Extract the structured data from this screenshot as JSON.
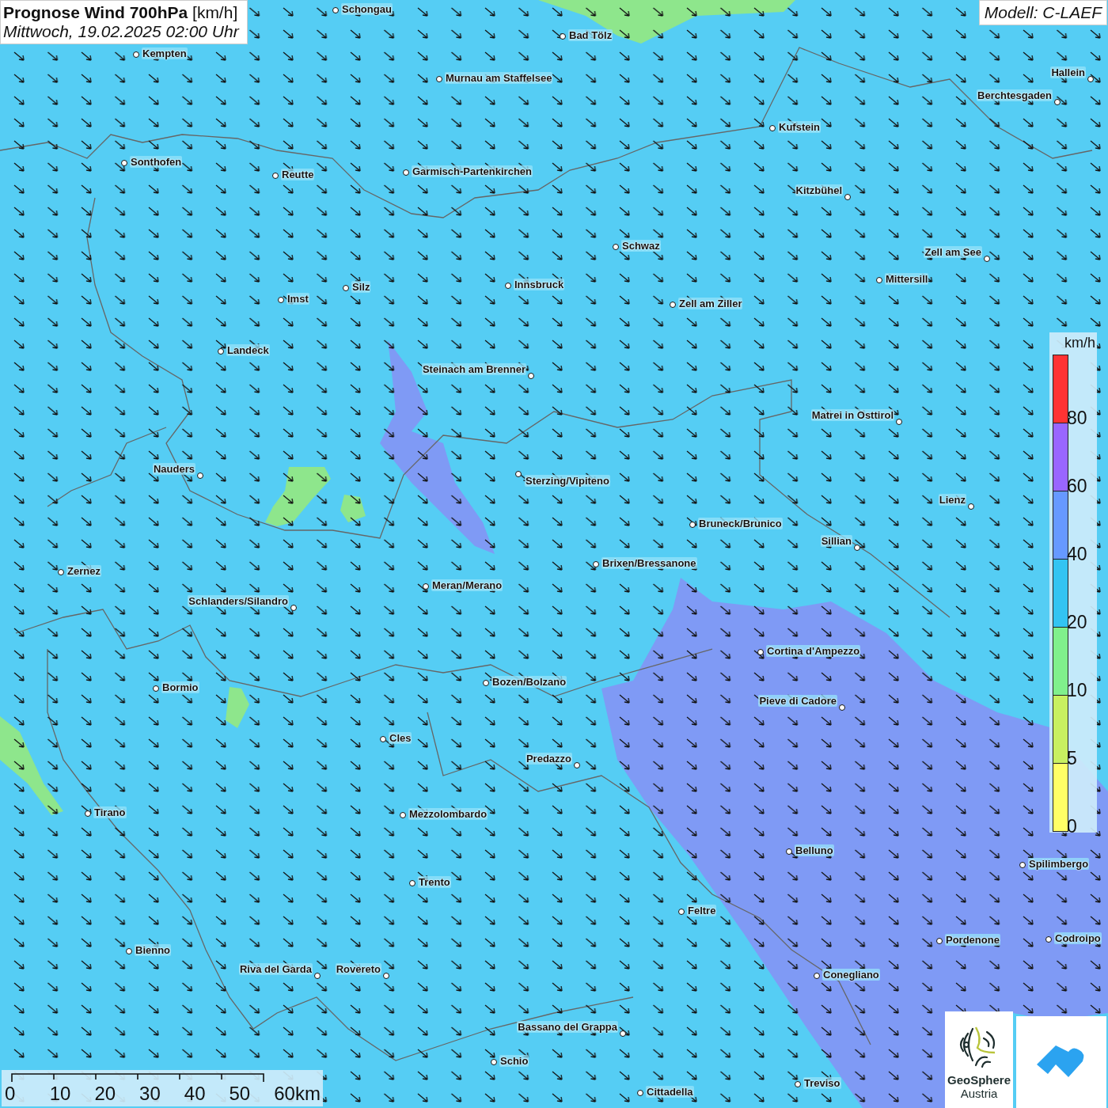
{
  "title": {
    "main": "Prognose Wind 700hPa",
    "unit": "[km/h]",
    "date": "Mittwoch, 19.02.2025 02:00 Uhr"
  },
  "model": "Modell: C-LAEF",
  "cities": [
    {
      "name": "Schongau"
    },
    {
      "name": "Bad Tölz"
    },
    {
      "name": "Kempten"
    },
    {
      "name": "Murnau am Staffelsee"
    },
    {
      "name": "Hallein"
    },
    {
      "name": "Berchtesgaden"
    },
    {
      "name": "Kufstein"
    },
    {
      "name": "Sonthofen"
    },
    {
      "name": "Reutte"
    },
    {
      "name": "Garmisch-Partenkirchen"
    },
    {
      "name": "Kitzbühel"
    },
    {
      "name": "Schwaz"
    },
    {
      "name": "Zell am See"
    },
    {
      "name": "Mittersill"
    },
    {
      "name": "Innsbruck"
    },
    {
      "name": "Silz"
    },
    {
      "name": "Imst"
    },
    {
      "name": "Zell am Ziller"
    },
    {
      "name": "Landeck"
    },
    {
      "name": "Steinach am Brenner"
    },
    {
      "name": "Matrei in Osttirol"
    },
    {
      "name": "Nauders"
    },
    {
      "name": "Sterzing/Vipiteno"
    },
    {
      "name": "Lienz"
    },
    {
      "name": "Bruneck/Brunico"
    },
    {
      "name": "Sillian"
    },
    {
      "name": "Brixen/Bressanone"
    },
    {
      "name": "Zernez"
    },
    {
      "name": "Meran/Merano"
    },
    {
      "name": "Schlanders/Silandro"
    },
    {
      "name": "Cortina d'Ampezzo"
    },
    {
      "name": "Bozen/Bolzano"
    },
    {
      "name": "Bormio"
    },
    {
      "name": "Pieve di Cadore"
    },
    {
      "name": "Cles"
    },
    {
      "name": "Predazzo"
    },
    {
      "name": "Tirano"
    },
    {
      "name": "Mezzolombardo"
    },
    {
      "name": "Belluno"
    },
    {
      "name": "Spilimbergo"
    },
    {
      "name": "Trento"
    },
    {
      "name": "Feltre"
    },
    {
      "name": "Pordenone"
    },
    {
      "name": "Codroipo"
    },
    {
      "name": "Bienno"
    },
    {
      "name": "Riva del Garda"
    },
    {
      "name": "Rovereto"
    },
    {
      "name": "Conegliano"
    },
    {
      "name": "Bassano del Grappa"
    },
    {
      "name": "Schio"
    },
    {
      "name": "Treviso"
    },
    {
      "name": "Cittadella"
    }
  ],
  "legend": {
    "unit": "km/h",
    "bins": [
      {
        "label": "80",
        "color": "#ff3333"
      },
      {
        "label": "60",
        "color": "#9966ff"
      },
      {
        "label": "40",
        "color": "#6699ff"
      },
      {
        "label": "20",
        "color": "#33c4f2"
      },
      {
        "label": "10",
        "color": "#80f08c"
      },
      {
        "label": "5",
        "color": "#c8f060"
      },
      {
        "label": "0",
        "color": "#ffff66"
      }
    ]
  },
  "scale_bar": {
    "labels": [
      "0",
      "10",
      "20",
      "30",
      "40",
      "50",
      "60km"
    ]
  },
  "logos": {
    "geosphere": [
      "GeoSphere",
      "Austria"
    ]
  }
}
